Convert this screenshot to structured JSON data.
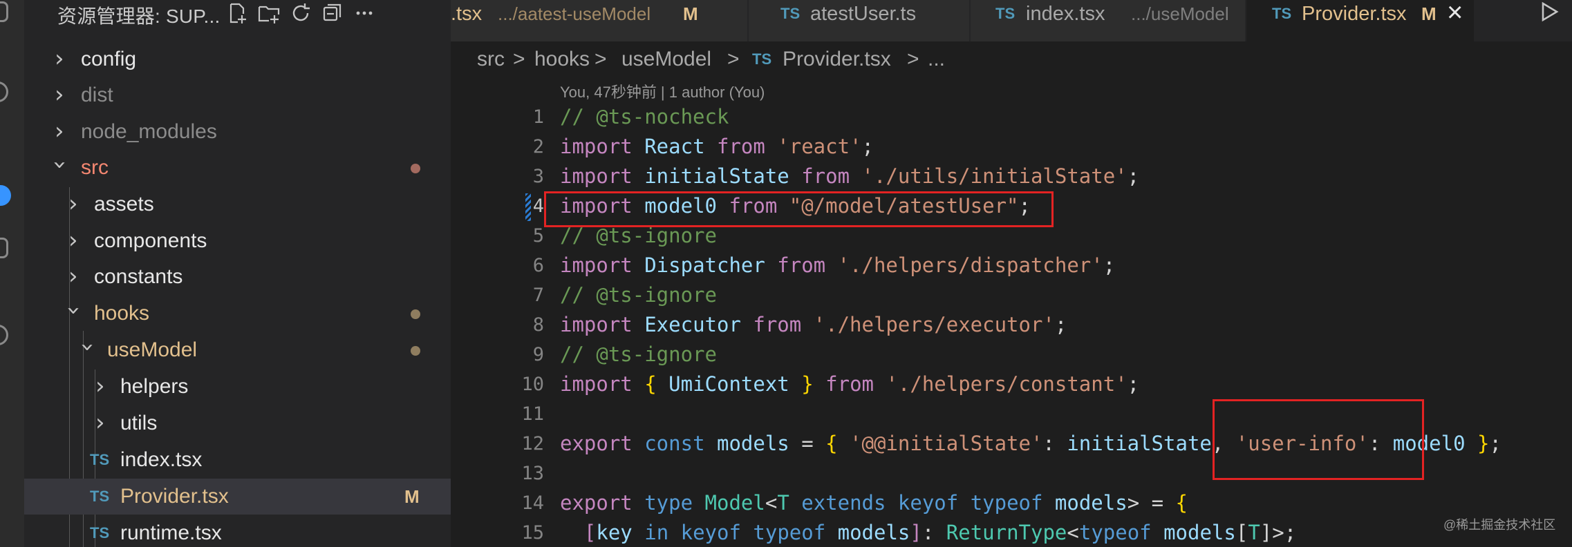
{
  "explorer": {
    "title": "资源管理器: SUP...",
    "tools": [
      "new-file-icon",
      "new-folder-icon",
      "refresh-icon",
      "collapse-all-icon",
      "more-icon"
    ],
    "items": [
      {
        "label": "config",
        "kind": "folder",
        "expanded": false
      },
      {
        "label": "dist",
        "kind": "folder",
        "expanded": false
      },
      {
        "label": "node_modules",
        "kind": "folder",
        "expanded": false
      },
      {
        "label": "src",
        "kind": "folder",
        "expanded": true
      },
      {
        "label": "assets",
        "kind": "folder",
        "expanded": false
      },
      {
        "label": "components",
        "kind": "folder",
        "expanded": false
      },
      {
        "label": "constants",
        "kind": "folder",
        "expanded": false
      },
      {
        "label": "hooks",
        "kind": "folder",
        "expanded": true
      },
      {
        "label": "useModel",
        "kind": "folder",
        "expanded": true
      },
      {
        "label": "helpers",
        "kind": "folder",
        "expanded": false
      },
      {
        "label": "utils",
        "kind": "folder",
        "expanded": false
      },
      {
        "label": "index.tsx",
        "kind": "file",
        "icon": "TS"
      },
      {
        "label": "Provider.tsx",
        "kind": "file",
        "icon": "TS",
        "badge": "M"
      },
      {
        "label": "runtime.tsx",
        "kind": "file",
        "icon": "TS"
      }
    ]
  },
  "tabs": [
    {
      "name": ".tsx",
      "path": ".../aatest-useModel",
      "badge": "M"
    },
    {
      "icon": "TS",
      "name": "atestUser.ts"
    },
    {
      "icon": "TS",
      "name": "index.tsx",
      "path": ".../useModel"
    },
    {
      "icon": "TS",
      "name": "Provider.tsx",
      "badge": "M",
      "close": "×"
    }
  ],
  "breadcrumb": [
    "src",
    ">",
    "hooks",
    ">",
    "useModel",
    ">",
    "TS",
    "Provider.tsx",
    ">",
    "..."
  ],
  "codelens": "You, 47秒钟前 | 1 author (You)",
  "lines": [
    "1",
    "2",
    "3",
    "4",
    "5",
    "6",
    "7",
    "8",
    "9",
    "10",
    "11",
    "12",
    "13",
    "14",
    "15"
  ],
  "code": {
    "l1": "// @ts-nocheck",
    "l2": [
      "import",
      " React ",
      "from",
      " 'react'",
      ";"
    ],
    "l3": [
      "import",
      " initialState ",
      "from",
      " './utils/initialState'",
      ";"
    ],
    "l4": [
      "import",
      " model0 ",
      "from",
      " \"@/model/atestUser\"",
      ";"
    ],
    "l5": "// @ts-ignore",
    "l6": [
      "import",
      " Dispatcher ",
      "from",
      " './helpers/dispatcher'",
      ";"
    ],
    "l7": "// @ts-ignore",
    "l8": [
      "import",
      " Executor ",
      "from",
      " './helpers/executor'",
      ";"
    ],
    "l9": "// @ts-ignore",
    "l10": [
      "import",
      " { ",
      "UmiContext",
      " } ",
      "from",
      " './helpers/constant'",
      ";"
    ],
    "l12": [
      "export",
      " const ",
      "models",
      " = ",
      "{",
      " '@@initialState'",
      ": ",
      "initialState",
      ", ",
      "'user-info'",
      ": ",
      "model0",
      " ",
      "}",
      ";"
    ],
    "l14": [
      "export",
      " type ",
      "Model",
      "<",
      "T",
      " extends ",
      "keyof",
      " typeof ",
      "models",
      ">",
      " = ",
      "{"
    ],
    "l15": [
      "  ",
      "[",
      "key",
      " in ",
      "keyof",
      " typeof ",
      "models",
      "]",
      ": ",
      "ReturnType",
      "<",
      "typeof",
      " models",
      "[",
      "T",
      "]",
      ">",
      ";"
    ]
  },
  "watermark": "@稀土掘金技术社区",
  "colors": {
    "highlight": "#e32323",
    "modified": "#e2c08d",
    "accent": "#3794ff"
  }
}
